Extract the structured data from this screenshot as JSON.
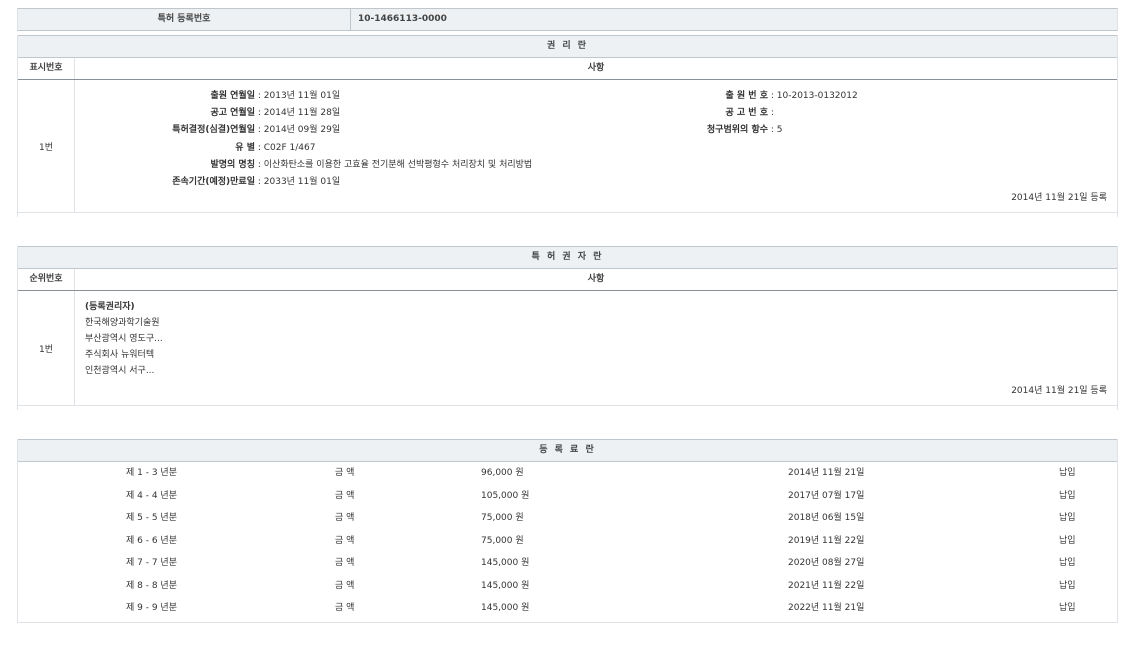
{
  "top": {
    "label": "특허 등록번호",
    "value": "10-1466113-0000"
  },
  "rights": {
    "title": "권 리 란",
    "col_num": "표시번호",
    "col_content": "사항",
    "row_num": "1번",
    "left": [
      {
        "k": "출원 연월일",
        "v": "2013년 11월 01일"
      },
      {
        "k": "공고 연월일",
        "v": "2014년 11월 28일"
      },
      {
        "k": "특허결정(심결)연월일",
        "v": "2014년 09월 29일"
      },
      {
        "k": "유 별",
        "v": "C02F 1/467"
      },
      {
        "k": "발명의 명칭",
        "v": "이산화탄소를 이용한 고효율 전기분해 선박평형수 처리장치 및 처리방법"
      },
      {
        "k": "존속기간(예정)만료일",
        "v": "2033년 11월 01일"
      }
    ],
    "right": [
      {
        "k": "출 원 번 호",
        "v": "10-2013-0132012"
      },
      {
        "k": "공 고 번 호",
        "v": ""
      },
      {
        "k": "청구범위의 항수",
        "v": "5"
      }
    ],
    "registered": "2014년 11월 21일 등록"
  },
  "holders": {
    "title": "특 허 권 자 란",
    "col_num": "순위번호",
    "col_content": "사항",
    "row_num": "1번",
    "lines": [
      "(등록권리자)",
      "한국해양과학기술원",
      "부산광역시 영도구...",
      "주식회사 뉴워터텍",
      "인천광역시 서구..."
    ],
    "registered": "2014년 11월 21일 등록"
  },
  "fees": {
    "title": "등 록 료 란",
    "rows": [
      {
        "period": "제 1 - 3 년분",
        "label": "금 액",
        "amount": "96,000 원",
        "date": "2014년 11월 21일",
        "status": "납입"
      },
      {
        "period": "제 4 - 4 년분",
        "label": "금 액",
        "amount": "105,000 원",
        "date": "2017년 07월 17일",
        "status": "납입"
      },
      {
        "period": "제 5 - 5 년분",
        "label": "금 액",
        "amount": "75,000 원",
        "date": "2018년 06월 15일",
        "status": "납입"
      },
      {
        "period": "제 6 - 6 년분",
        "label": "금 액",
        "amount": "75,000 원",
        "date": "2019년 11월 22일",
        "status": "납입"
      },
      {
        "period": "제 7 - 7 년분",
        "label": "금 액",
        "amount": "145,000 원",
        "date": "2020년 08월 27일",
        "status": "납입"
      },
      {
        "period": "제 8 - 8 년분",
        "label": "금 액",
        "amount": "145,000 원",
        "date": "2021년 11월 22일",
        "status": "납입"
      },
      {
        "period": "제 9 - 9 년분",
        "label": "금 액",
        "amount": "145,000 원",
        "date": "2022년 11월 21일",
        "status": "납입"
      }
    ]
  }
}
